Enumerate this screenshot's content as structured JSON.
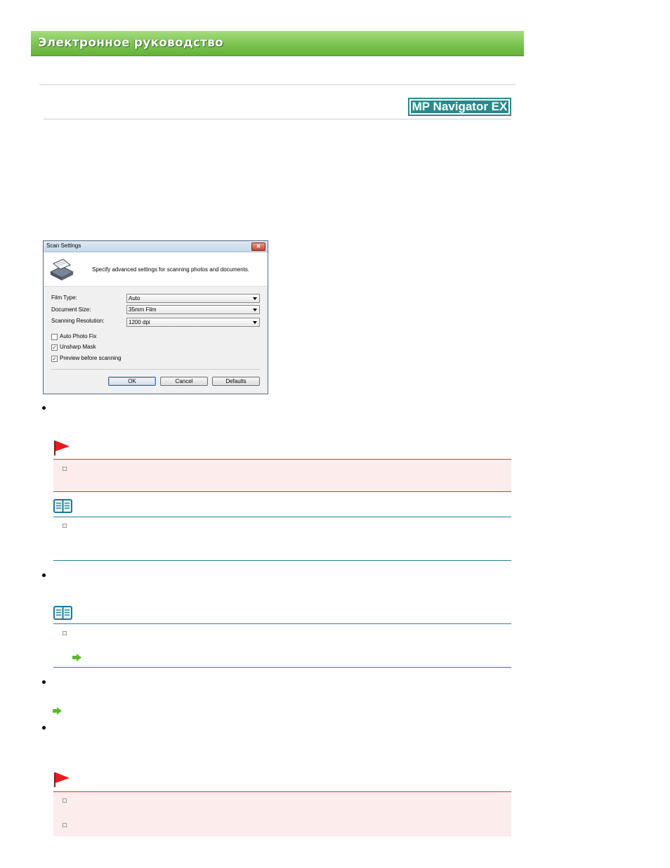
{
  "banner": {
    "title": "Электронное руководство"
  },
  "logo": {
    "text": "MP Navigator EX"
  },
  "dialog": {
    "title": "Scan Settings",
    "description": "Specify advanced settings for scanning photos and documents.",
    "fields": [
      {
        "label": "Film Type:",
        "value": "Auto"
      },
      {
        "label": "Document Size:",
        "value": "35mm Film"
      },
      {
        "label": "Scanning Resolution:",
        "value": "1200 dpi"
      }
    ],
    "checkboxes": [
      {
        "label": "Auto Photo Fix",
        "checked": false
      },
      {
        "label": "Unsharp Mask",
        "checked": true
      },
      {
        "label": "Preview before scanning",
        "checked": true
      }
    ],
    "buttons": {
      "ok": "OK",
      "cancel": "Cancel",
      "defaults": "Defaults"
    },
    "close_glyph": "✕",
    "check_glyph": "✓"
  },
  "icons": {
    "flag": "flag-icon",
    "note": "note-book-icon",
    "arrow": "arrow-right-icon",
    "scanner": "scanner-icon"
  },
  "colors": {
    "banner_green": "#7bc44f",
    "logo_teal": "#2a8a8a",
    "important_red": "#d33a3a",
    "note_blue": "#2a7f9e",
    "important_bg": "#fcecec",
    "link_arrow_green": "#5cb82e"
  }
}
